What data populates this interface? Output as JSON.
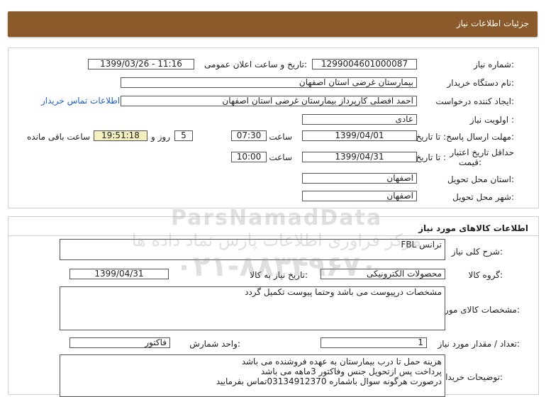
{
  "header": {
    "title": "جزئیات اطلاعات نیاز"
  },
  "need_info": {
    "need_number_label": "شماره نیاز:",
    "need_number": "1299004601000087",
    "announce_label": "تاریخ و ساعت اعلان عمومی:",
    "announce_value": "1399/03/26 - 11:16",
    "buyer_org_label": "نام دستگاه خریدار:",
    "buyer_org": "بیمارستان غرضی استان اصفهان",
    "creator_label": "ایجاد کننده درخواست:",
    "creator": "احمد افضلی کارپرداز بیمارستان غرضی استان اصفهان",
    "contact_link": "اطلاعات تماس خریدار",
    "priority_label": "اولویت نیاز :",
    "priority": "عادی",
    "deadline_label": "مهلت ارسال پاسخ:",
    "to_date_label": "تا تاریخ :",
    "deadline_date": "1399/04/01",
    "time_label": "ساعت",
    "deadline_time": "07:30",
    "days_value": "5",
    "days_label": "روز و",
    "remaining_time": "19:51:18",
    "remaining_label": "ساعت باقی مانده",
    "validity_label_line1": "حداقل تاریخ اعتبار",
    "validity_label_line2": "قیمت:",
    "validity_to_label": "تا تاریخ :",
    "validity_date": "1399/04/31",
    "validity_time_label": "ساعت",
    "validity_time": "10:00",
    "province_label": "استان محل تحویل:",
    "province": "اصفهان",
    "city_label": "شهر محل تحویل:",
    "city": "اصفهان"
  },
  "goods": {
    "section_title": "اطلاعات کالاهای مورد نیاز",
    "desc_label": "شرح کلی نیاز:",
    "desc": "ترانس FBL",
    "group_label": "گروه کالا:",
    "group": "محصولات الکترونیکی",
    "need_date_label": "تاریخ نیاز به کالا:",
    "need_date": "1399/04/31",
    "spec_label": "مشخصات کالای مورد نیاز:",
    "spec": "مشخصات درپیوست می باشد وحتما پیوست تکمیل گردد",
    "qty_label": "تعداد / مقدار مورد نیاز:",
    "qty": "1",
    "unit_label": "واحد شمارش:",
    "unit": "فاکتور",
    "buyer_notes_label": "توضیحات خریدار:",
    "buyer_notes_line1": "هزینه حمل تا درب بیمارستان به عهده فروشنده می باشد",
    "buyer_notes_line2": "پرداخت پس ازتحویل جنس وفاکتور 3ماهه می باشد",
    "buyer_notes_line3": "درصورت هرگونه سوال باشماره 03134912370تماس بفرمایید"
  },
  "watermark": {
    "brand": "ParsNamadData",
    "tagline": "مرکز فراوری اطلاعات پارس نماد داده ها",
    "phone": "۰۲۱-۸۸۳۴۹۶۷۰"
  },
  "colors": {
    "header": "#8b5a2b",
    "link": "#1f5fbf",
    "highlight": "#f4f0c0"
  }
}
